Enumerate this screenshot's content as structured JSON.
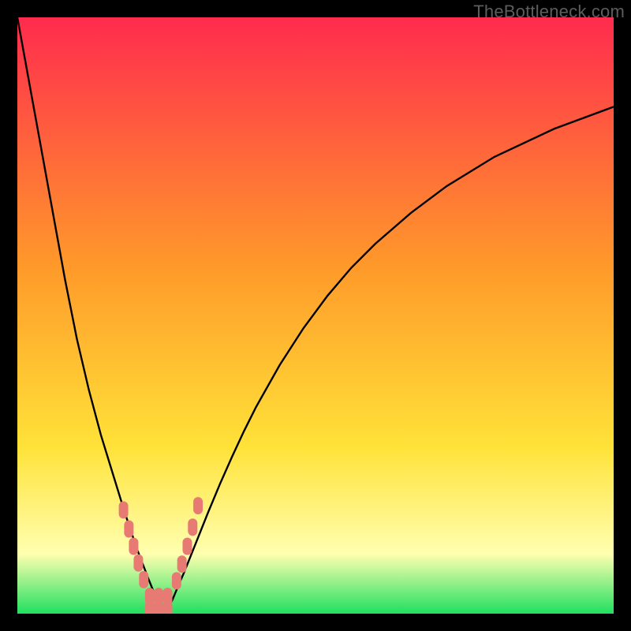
{
  "watermark": "TheBottleneck.com",
  "colors": {
    "frame": "#000000",
    "curve": "#000000",
    "marker_fill": "#e77b74",
    "marker_stroke": "#e77b74",
    "grad_top": "#ff2b4e",
    "grad_mid1": "#ff9a2a",
    "grad_mid2": "#ffe238",
    "grad_yellowwhite": "#ffffb0",
    "grad_bottom": "#20e060"
  },
  "chart_data": {
    "type": "line",
    "title": "",
    "xlabel": "",
    "ylabel": "",
    "xlim": [
      0,
      100
    ],
    "ylim": [
      0,
      100
    ],
    "curve": {
      "x": [
        0,
        2,
        4,
        6,
        8,
        10,
        12,
        14,
        16,
        18,
        19,
        20,
        21,
        22,
        23,
        24,
        25,
        26,
        27,
        28,
        30,
        32,
        34,
        36,
        38,
        40,
        44,
        48,
        52,
        56,
        60,
        66,
        72,
        80,
        90,
        100
      ],
      "y": [
        100,
        89,
        78,
        67,
        56,
        46,
        37.5,
        30,
        23.5,
        17,
        14,
        11,
        8.4,
        5.8,
        3.3,
        1.3,
        0.7,
        2.3,
        4.7,
        7,
        12,
        17,
        21.8,
        26.3,
        30.6,
        34.6,
        41.7,
        47.9,
        53.3,
        58,
        62,
        67.2,
        71.7,
        76.6,
        81.3,
        85
      ]
    },
    "markers": {
      "type": "pill",
      "x": [
        17.8,
        18.7,
        19.5,
        20.3,
        21.2,
        22.2,
        22.2,
        23.7,
        23.7,
        25.2,
        25.2,
        26.7,
        27.6,
        28.5,
        29.4,
        30.3
      ],
      "y": [
        17.4,
        14.2,
        11.3,
        8.5,
        5.7,
        2.9,
        0.7,
        0.7,
        2.9,
        0.7,
        2.9,
        5.5,
        8.3,
        11.3,
        14.5,
        18.1
      ]
    }
  }
}
